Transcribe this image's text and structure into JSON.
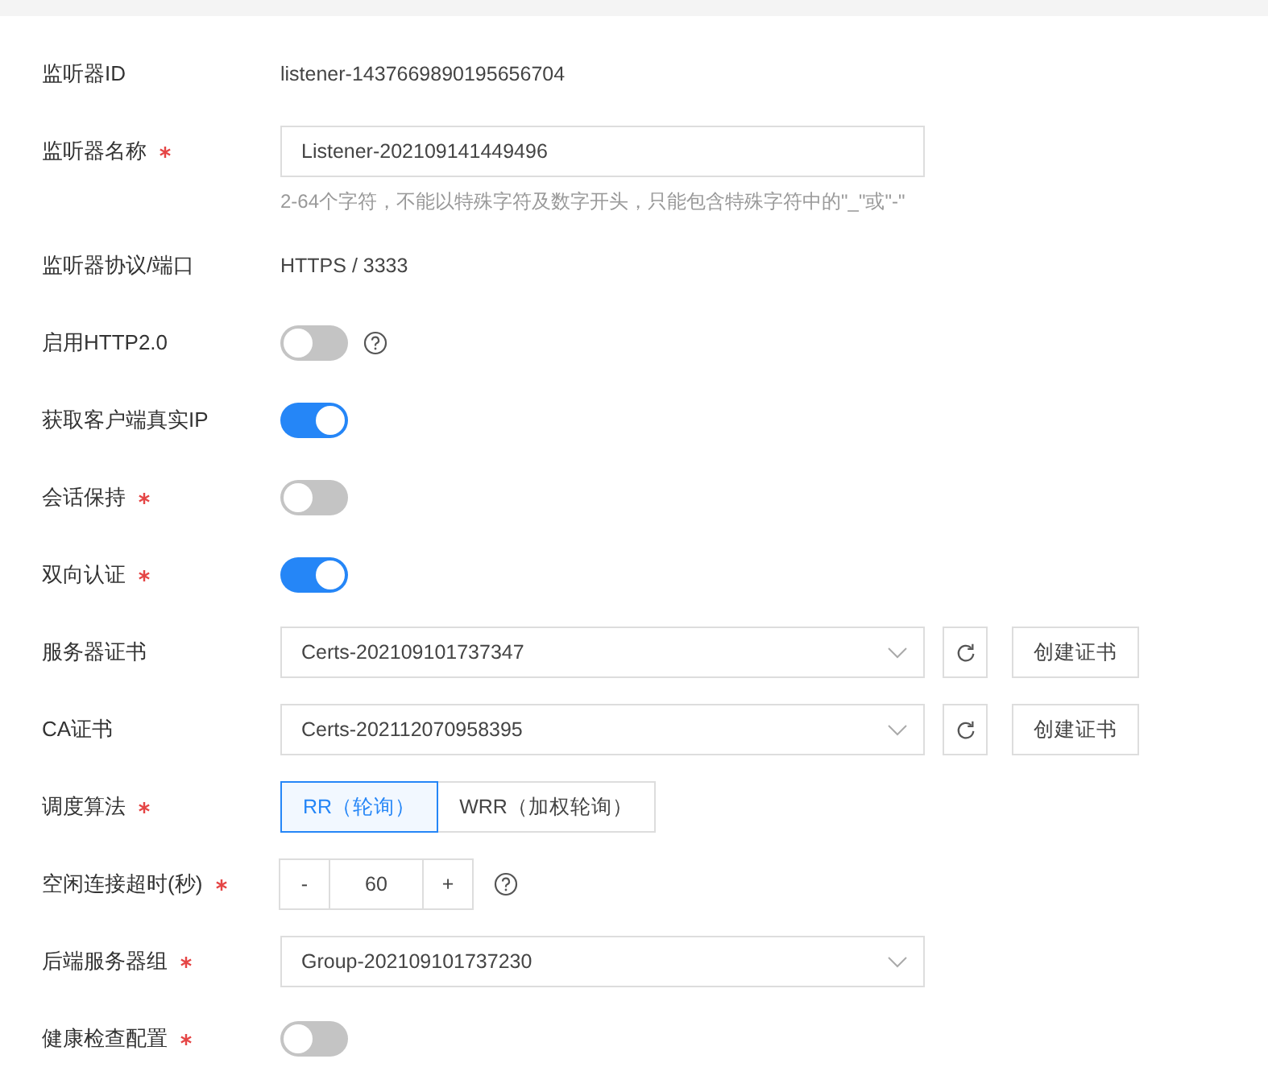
{
  "fields": [
    {
      "kind": "text",
      "label": "监听器ID",
      "required": false,
      "value": "listener-1437669890195656704"
    },
    {
      "kind": "input",
      "label": "监听器名称",
      "required": true,
      "value": "Listener-202109141449496",
      "hint": "2-64个字符，不能以特殊字符及数字开头，只能包含特殊字符中的\"_\"或\"-\""
    },
    {
      "kind": "text",
      "label": "监听器协议/端口",
      "required": false,
      "value": "HTTPS / 3333"
    },
    {
      "kind": "switch",
      "label": "启用HTTP2.0",
      "required": false,
      "on": false,
      "help": true
    },
    {
      "kind": "switch",
      "label": "获取客户端真实IP",
      "required": false,
      "on": true,
      "help": false
    },
    {
      "kind": "switch",
      "label": "会话保持",
      "required": true,
      "on": false,
      "help": false
    },
    {
      "kind": "switch",
      "label": "双向认证",
      "required": true,
      "on": true,
      "help": false
    },
    {
      "kind": "select",
      "label": "服务器证书",
      "required": false,
      "value": "Certs-202109101737347",
      "button": "创建证书"
    },
    {
      "kind": "select",
      "label": "CA证书",
      "required": false,
      "value": "Certs-202112070958395",
      "button": "创建证书"
    },
    {
      "kind": "radio",
      "label": "调度算法",
      "required": true,
      "options": [
        {
          "label": "RR（轮询）",
          "selected": true
        },
        {
          "label": "WRR（加权轮询）",
          "selected": false
        }
      ]
    },
    {
      "kind": "number",
      "label": "空闲连接超时(秒)",
      "required": true,
      "value": "60",
      "minus": "-",
      "plus": "+",
      "help": true
    },
    {
      "kind": "select",
      "label": "后端服务器组",
      "required": true,
      "value": "Group-202109101737230"
    },
    {
      "kind": "switch",
      "label": "健康检查配置",
      "required": true,
      "on": false,
      "help": false
    }
  ]
}
